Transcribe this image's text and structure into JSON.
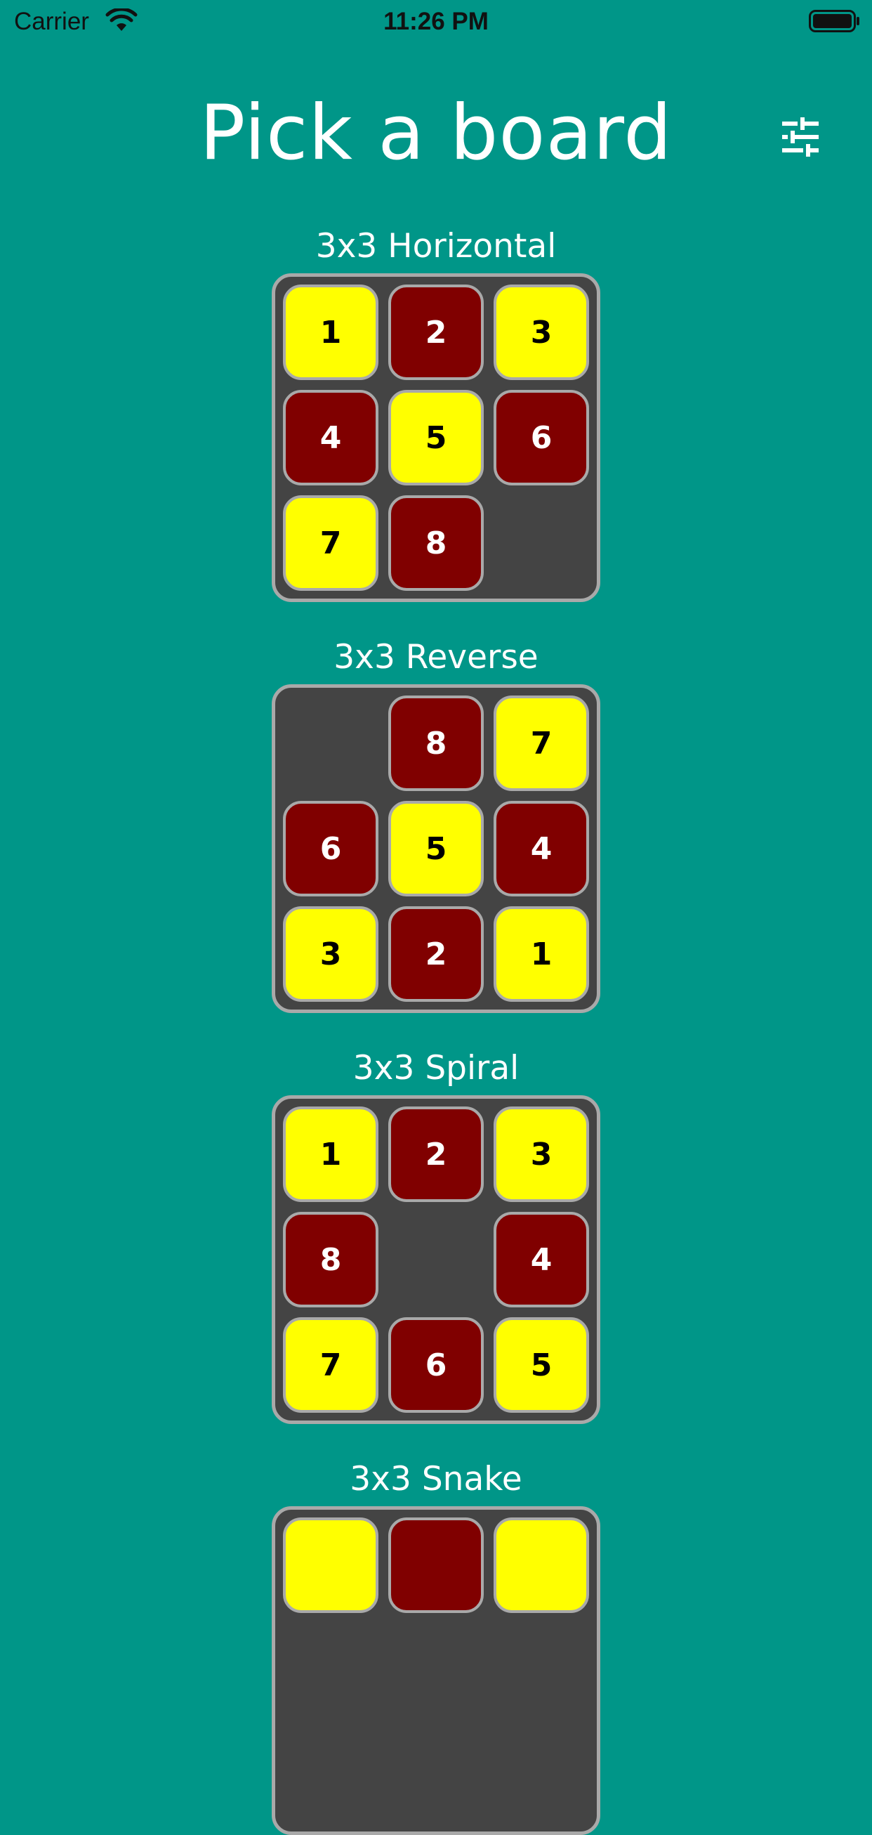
{
  "status_bar": {
    "carrier": "Carrier",
    "time": "11:26 PM"
  },
  "header": {
    "title": "Pick a board",
    "settings_icon": "sliders-icon"
  },
  "colors": {
    "background": "#009688",
    "board": "#444444",
    "border": "#a9a9a9",
    "tile_yellow": "#ffff00",
    "tile_maroon": "#800000"
  },
  "boards": [
    {
      "name": "3x3 Horizontal",
      "tiles": [
        {
          "label": "1",
          "color": "yellow"
        },
        {
          "label": "2",
          "color": "maroon"
        },
        {
          "label": "3",
          "color": "yellow"
        },
        {
          "label": "4",
          "color": "maroon"
        },
        {
          "label": "5",
          "color": "yellow"
        },
        {
          "label": "6",
          "color": "maroon"
        },
        {
          "label": "7",
          "color": "yellow"
        },
        {
          "label": "8",
          "color": "maroon"
        },
        null
      ]
    },
    {
      "name": "3x3 Reverse",
      "tiles": [
        null,
        {
          "label": "8",
          "color": "maroon"
        },
        {
          "label": "7",
          "color": "yellow"
        },
        {
          "label": "6",
          "color": "maroon"
        },
        {
          "label": "5",
          "color": "yellow"
        },
        {
          "label": "4",
          "color": "maroon"
        },
        {
          "label": "3",
          "color": "yellow"
        },
        {
          "label": "2",
          "color": "maroon"
        },
        {
          "label": "1",
          "color": "yellow"
        }
      ]
    },
    {
      "name": "3x3 Spiral",
      "tiles": [
        {
          "label": "1",
          "color": "yellow"
        },
        {
          "label": "2",
          "color": "maroon"
        },
        {
          "label": "3",
          "color": "yellow"
        },
        {
          "label": "8",
          "color": "maroon"
        },
        null,
        {
          "label": "4",
          "color": "maroon"
        },
        {
          "label": "7",
          "color": "yellow"
        },
        {
          "label": "6",
          "color": "maroon"
        },
        {
          "label": "5",
          "color": "yellow"
        }
      ]
    },
    {
      "name": "3x3 Snake",
      "tiles": [
        {
          "label": "",
          "color": "yellow"
        },
        {
          "label": "",
          "color": "maroon"
        },
        {
          "label": "",
          "color": "yellow"
        },
        null,
        null,
        null,
        null,
        null,
        null
      ]
    }
  ]
}
